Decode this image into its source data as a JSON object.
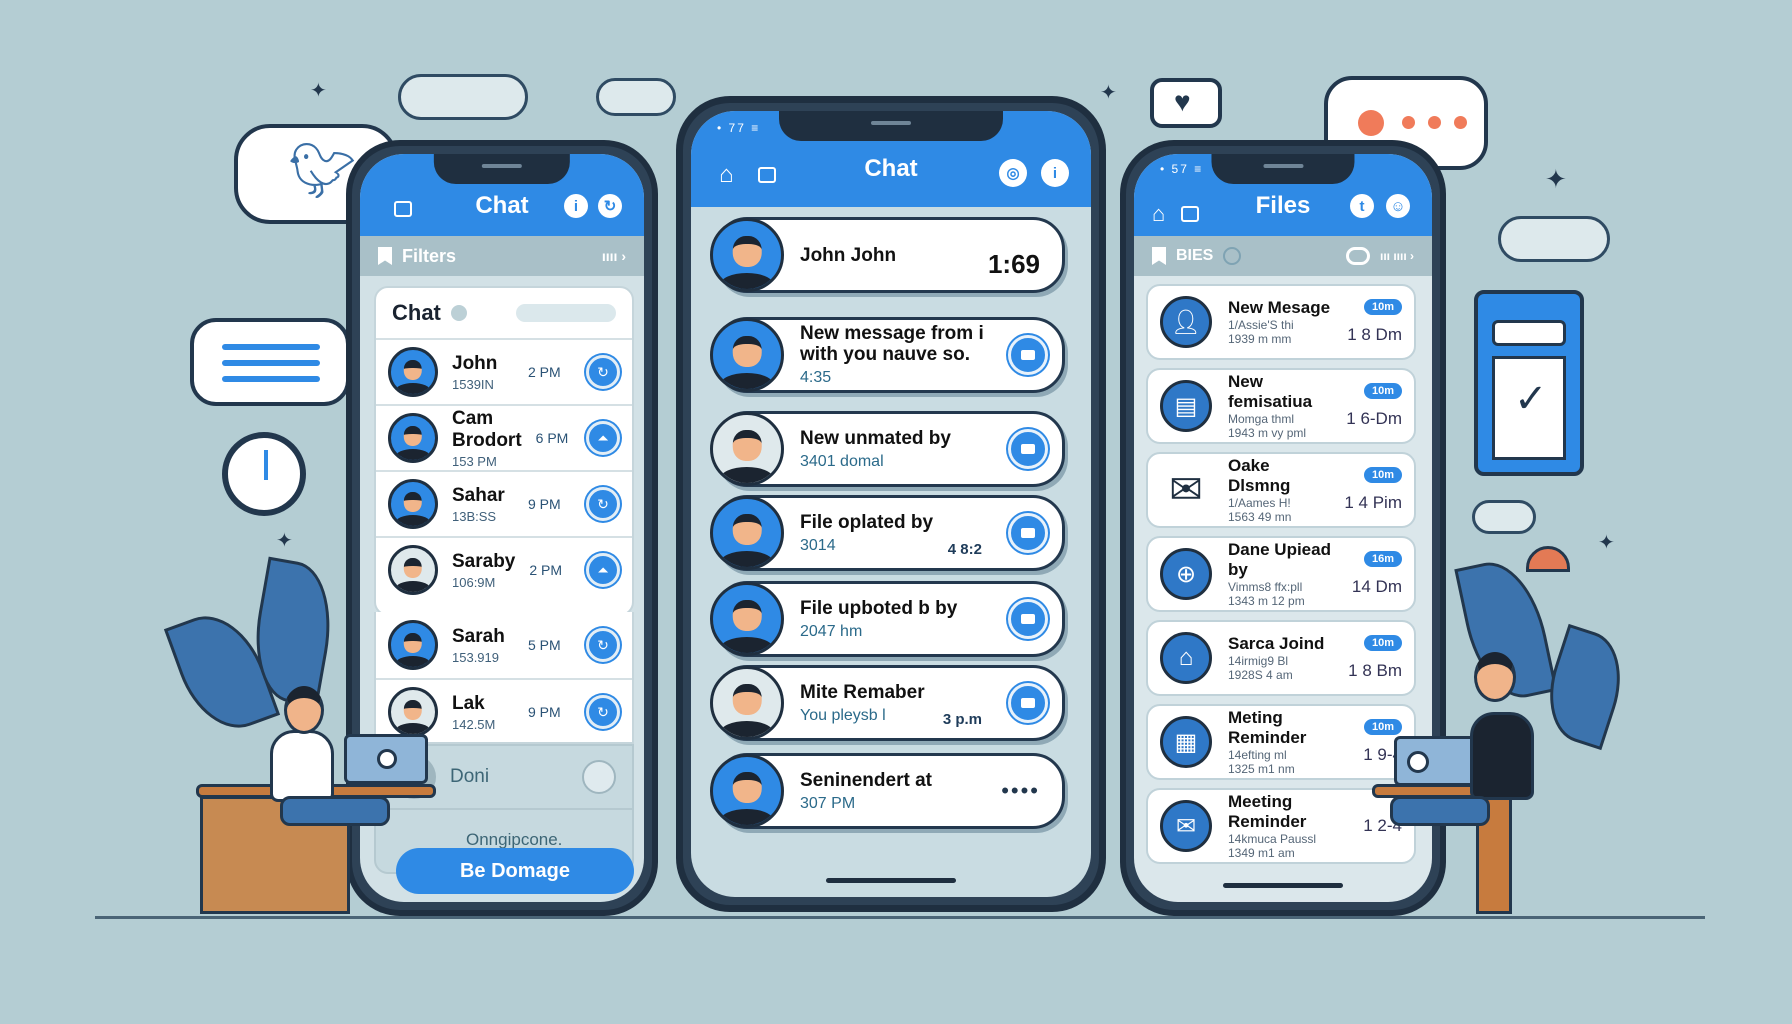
{
  "left_phone": {
    "appbar_title": "Chat",
    "appbar_icons": [
      "grid-icon",
      "info-icon",
      "refresh-icon"
    ],
    "filter_label": "Filters",
    "list_header": "Chat",
    "contacts": [
      {
        "name": "John",
        "sub": "1539IN",
        "time": "2 PM",
        "action": "refresh"
      },
      {
        "name": "Cam Brodort",
        "sub": "153 PM",
        "time": "6 PM",
        "action": "upload"
      },
      {
        "name": "Sahar",
        "sub": "13B:SS",
        "time": "9 PM",
        "action": "refresh"
      },
      {
        "name": "Saraby",
        "sub": "106:9M",
        "time": "2 PM",
        "action": "upload"
      },
      {
        "name": "Sarah",
        "sub": "153.919",
        "time": "5 PM",
        "action": "refresh"
      },
      {
        "name": "Lak",
        "sub": "142.5M",
        "time": "9 PM",
        "action": "refresh"
      }
    ],
    "faded_rows": [
      {
        "name": "Doni"
      },
      {
        "name": "Onngipcone."
      }
    ],
    "primary_button": "Be Domage"
  },
  "center_phone": {
    "status": "• 77 ≡",
    "appbar_title": "Chat",
    "messages": [
      {
        "title": "John John",
        "sub": "",
        "time": "1:69",
        "action": false
      },
      {
        "title": "New message from i\nwith you nauve so.",
        "sub": "4:35",
        "time": "",
        "action": true
      },
      {
        "title": "New unmated by",
        "sub": "3401   domal",
        "time": "",
        "action": true
      },
      {
        "title": "File oplated by",
        "sub": "3014",
        "time": "4 8:2",
        "action": true
      },
      {
        "title": "File upboted b by",
        "sub": "2047 hm",
        "time": "",
        "action": true
      },
      {
        "title": "Mite Remaber",
        "sub": "You   pleysb l",
        "time": "3 p.m",
        "action": true
      },
      {
        "title": "Seninendert at",
        "sub": "307 PM",
        "time": "",
        "action": false,
        "more": "••••"
      }
    ]
  },
  "right_phone": {
    "status": "• 57 ≡",
    "appbar_title": "Files",
    "filter_label": "BIES",
    "files": [
      {
        "title": "New Mesage",
        "sub1": "1/Assie'S thi",
        "sub2": "1939 m mm",
        "badge": "10m",
        "date": "1 8 Dm",
        "icon": "person"
      },
      {
        "title": "New femisatiua",
        "sub1": "Momga thml",
        "sub2": "1943 m vy pml",
        "badge": "10m",
        "date": "1 6-Dm",
        "icon": "document"
      },
      {
        "title": "Oake Dlsmng",
        "sub1": "1/Aames H!",
        "sub2": "1563 49 mn",
        "badge": "10m",
        "date": "1 4 Pim",
        "icon": "envelope"
      },
      {
        "title": "Dane Upiead by",
        "sub1": "Vimms8 ffx:pll",
        "sub2": "1343 m 12 pm",
        "badge": "16m",
        "date": "14 Dm",
        "icon": "add-file"
      },
      {
        "title": "Sarca Joind",
        "sub1": "14irmig9 Bl",
        "sub2": "1928S 4 am",
        "badge": "10m",
        "date": "1 8 Bm",
        "icon": "bag"
      },
      {
        "title": "Meting Reminder",
        "sub1": "14efting ml",
        "sub2": "1325 m1 nm",
        "badge": "10m",
        "date": "1 9-4",
        "icon": "clipboard"
      },
      {
        "title": "Meeting Reminder",
        "sub1": "14kmuca Paussl",
        "sub2": "1349 m1 am",
        "badge": "",
        "date": "1 2-4",
        "icon": "envelope"
      }
    ]
  },
  "decor": {
    "typing_dots_color": "#f07b5a",
    "accent": "#2f8ae5"
  }
}
